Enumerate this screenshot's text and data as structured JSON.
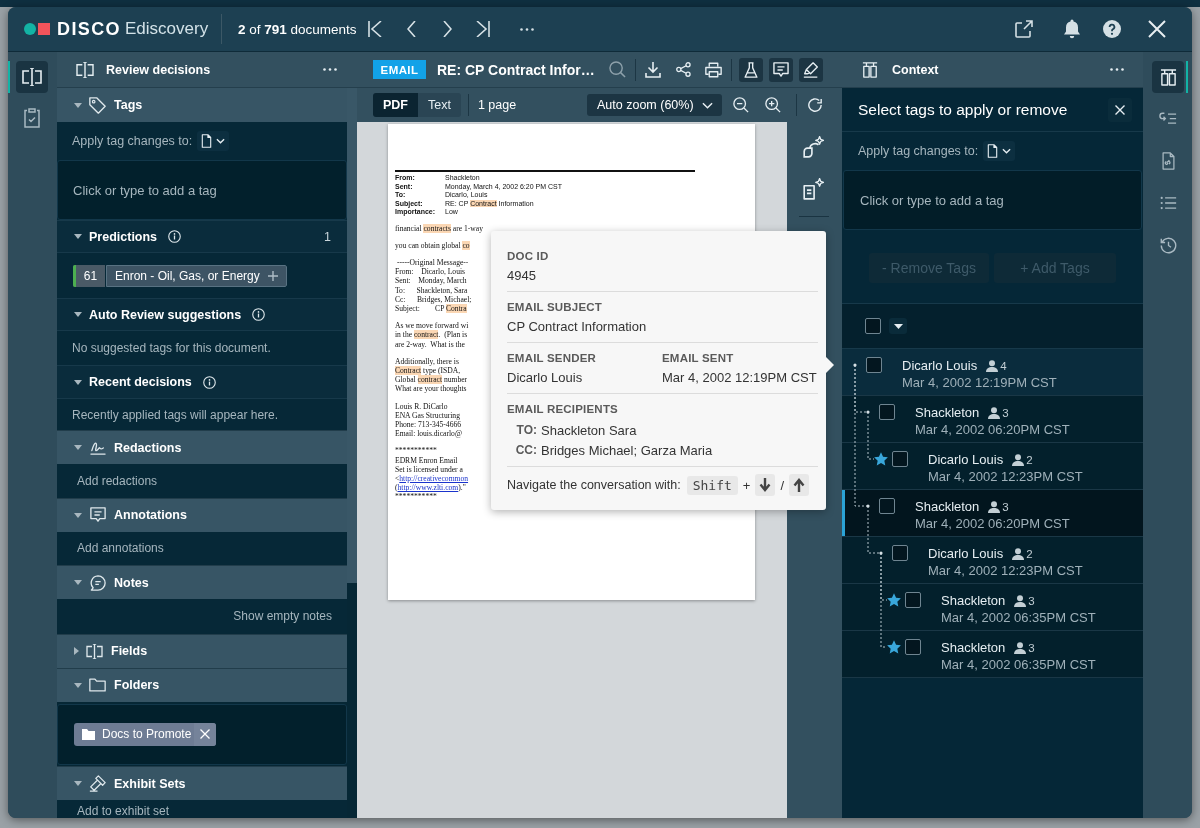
{
  "app_bar": {
    "brand": "DISCO",
    "product": "Ediscovery",
    "position": "**2** of **791** documents"
  },
  "left_rail": [
    {
      "kind": "review",
      "selected": true
    },
    {
      "kind": "checklist",
      "selected": false
    }
  ],
  "review_panel": {
    "title": "Review decisions",
    "sections": [
      {
        "kind": "tags",
        "title": "Tags",
        "expanded": true,
        "apply_label": "Apply tag changes to:",
        "tag_input": {
          "placeholder": "Click or type to add a tag"
        },
        "subsections": [
          {
            "kind": "predictions",
            "title": "Predictions",
            "expanded": true,
            "count": "1",
            "predictions": [
              {
                "score": "61",
                "label": "Enron - Oil, Gas, or Energy"
              }
            ]
          },
          {
            "kind": "message",
            "title": "Auto Review suggestions",
            "expanded": true,
            "message": "No suggested tags for this document."
          },
          {
            "kind": "message",
            "title": "Recent decisions",
            "expanded": true,
            "message": "Recently applied tags will appear here."
          }
        ]
      },
      {
        "kind": "redactions",
        "title": "Redactions",
        "expanded": true,
        "hint": "Add redactions"
      },
      {
        "kind": "annotations",
        "title": "Annotations",
        "expanded": true,
        "hint": "Add annotations"
      },
      {
        "kind": "notes",
        "title": "Notes",
        "expanded": true,
        "link": "Show empty notes"
      },
      {
        "kind": "fields",
        "title": "Fields",
        "expanded": false
      },
      {
        "kind": "folders",
        "title": "Folders",
        "expanded": true,
        "folders": [
          {
            "label": "Docs to Promote"
          }
        ]
      },
      {
        "kind": "exhibit_sets",
        "title": "Exhibit Sets",
        "expanded": true,
        "hint": "Add to exhibit set"
      }
    ]
  },
  "document": {
    "type_badge": "EMAIL",
    "title": "RE: CP Contract Infor…",
    "view_modes": [
      {
        "label": "PDF",
        "selected": true
      },
      {
        "label": "Text",
        "selected": false
      }
    ],
    "page_count": "1 page",
    "zoom": "Auto zoom (60%)",
    "page": {
      "header": [
        {
          "label": "From:",
          "value": [
            {
              "kind": "plain",
              "text": "Shackleton"
            }
          ]
        },
        {
          "label": "Sent:",
          "value": [
            {
              "kind": "plain",
              "text": "Monday, March 4, 2002 6:20 PM CST"
            }
          ]
        },
        {
          "label": "To:",
          "value": [
            {
              "kind": "plain",
              "text": "Dicarlo, Louis"
            }
          ]
        },
        {
          "label": "Subject:",
          "value": [
            {
              "kind": "plain",
              "text": "RE: CP "
            },
            {
              "kind": "highlight",
              "text": "Contract"
            },
            {
              "kind": "plain",
              "text": " Information"
            }
          ]
        },
        {
          "label": "Importance:",
          "value": [
            {
              "kind": "plain",
              "text": "Low"
            }
          ]
        }
      ],
      "paragraphs": [
        [
          [
            {
              "kind": "plain",
              "text": "financial "
            },
            {
              "kind": "highlight",
              "text": "contracts"
            },
            {
              "kind": "plain",
              "text": " are 1-way"
            }
          ]
        ],
        [
          [
            {
              "kind": "plain",
              "text": "you can obtain global "
            },
            {
              "kind": "highlight",
              "text": "co"
            }
          ]
        ],
        [
          [
            {
              "kind": "plain",
              "text": " -----Original Message--"
            }
          ],
          [
            {
              "kind": "plain",
              "text": "From:    Dicarlo, Louis"
            }
          ],
          [
            {
              "kind": "plain",
              "text": "Sent:    Monday, March"
            }
          ],
          [
            {
              "kind": "plain",
              "text": "To:      Shackleton, Sara"
            }
          ],
          [
            {
              "kind": "plain",
              "text": "Cc:      Bridges, Michael;"
            }
          ],
          [
            {
              "kind": "plain",
              "text": "Subject:        CP "
            },
            {
              "kind": "highlight",
              "text": "Contra"
            }
          ]
        ],
        [
          [
            {
              "kind": "plain",
              "text": "As we move forward wi"
            }
          ],
          [
            {
              "kind": "plain",
              "text": "in the "
            },
            {
              "kind": "highlight",
              "text": "contract"
            },
            {
              "kind": "plain",
              "text": ".  (Plan is"
            }
          ],
          [
            {
              "kind": "plain",
              "text": "are 2-way.  What is the"
            }
          ]
        ],
        [
          [
            {
              "kind": "plain",
              "text": "Additionally, there is"
            }
          ],
          [
            {
              "kind": "highlight",
              "text": "Contract"
            },
            {
              "kind": "plain",
              "text": " type (ISDA,"
            }
          ],
          [
            {
              "kind": "plain",
              "text": "Global "
            },
            {
              "kind": "highlight",
              "text": "contract"
            },
            {
              "kind": "plain",
              "text": " number"
            }
          ],
          [
            {
              "kind": "plain",
              "text": "What are your thoughts"
            }
          ]
        ],
        [
          [
            {
              "kind": "plain",
              "text": "Louis R. DiCarlo"
            }
          ],
          [
            {
              "kind": "plain",
              "text": "ENA Gas Structuring"
            }
          ],
          [
            {
              "kind": "plain",
              "text": "Phone: 713-345-4666"
            }
          ],
          [
            {
              "kind": "plain",
              "text": "Email: louis.dicarlo@"
            }
          ]
        ],
        [
          [
            {
              "kind": "plain",
              "text": "***********"
            }
          ],
          [
            {
              "kind": "plain",
              "text": "EDRM Enron Email"
            }
          ],
          [
            {
              "kind": "plain",
              "text": "Set is licensed under a"
            }
          ],
          [
            {
              "kind": "plain",
              "text": "<"
            },
            {
              "kind": "link",
              "text": "http://creativecommon"
            }
          ],
          [
            {
              "kind": "plain",
              "text": "("
            },
            {
              "kind": "link",
              "text": "http://www.zlti.com"
            },
            {
              "kind": "plain",
              "text": ").\""
            }
          ],
          [
            {
              "kind": "plain",
              "text": "***********"
            }
          ]
        ]
      ]
    }
  },
  "doc_popover": {
    "rows": [
      {
        "fields": [
          {
            "label": "DOC ID",
            "value": "4945"
          }
        ]
      },
      {
        "fields": [
          {
            "label": "EMAIL SUBJECT",
            "value": "CP Contract Information"
          }
        ]
      },
      {
        "fields": [
          {
            "label": "EMAIL SENDER",
            "value": "Dicarlo Louis"
          },
          {
            "label": "EMAIL SENT",
            "value": "Mar 4, 2002 12:19PM CST"
          }
        ]
      }
    ],
    "recipients": {
      "label": "EMAIL RECIPIENTS",
      "lines": [
        {
          "role": "TO:",
          "value": "Shackleton Sara"
        },
        {
          "role": "CC:",
          "value": "Bridges Michael; Garza Maria"
        }
      ]
    },
    "shortcut": {
      "text": "Navigate the conversation with:",
      "key": "Shift",
      "plus": "+",
      "separator": "/"
    }
  },
  "context_panel": {
    "title": "Context",
    "tag_editor": {
      "title": "Select tags to apply or remove",
      "apply_label": "Apply tag changes to:",
      "tag_input": {
        "placeholder": "Click or type to add a tag"
      },
      "buttons": [
        {
          "label": "- Remove Tags",
          "disabled": true
        },
        {
          "label": "+ Add Tags",
          "disabled": true
        }
      ]
    },
    "select_all": {
      "checked": false
    },
    "thread": [
      {
        "name": "Dicarlo Louis",
        "participants": "4",
        "date": "Mar 4, 2002 12:19PM CST",
        "starred": false,
        "checked": false,
        "selected": false,
        "current": true,
        "children": [
          {
            "name": "Shackleton",
            "participants": "3",
            "date": "Mar 4, 2002 06:20PM CST",
            "starred": false,
            "checked": false,
            "selected": false,
            "current": false,
            "children": [
              {
                "name": "Dicarlo Louis",
                "participants": "2",
                "date": "Mar 4, 2002 12:23PM CST",
                "starred": true,
                "checked": false,
                "selected": false,
                "current": false
              }
            ]
          },
          {
            "name": "Shackleton",
            "participants": "3",
            "date": "Mar 4, 2002 06:20PM CST",
            "starred": false,
            "checked": false,
            "selected": true,
            "current": false,
            "children": [
              {
                "name": "Dicarlo Louis",
                "participants": "2",
                "date": "Mar 4, 2002 12:23PM CST",
                "starred": false,
                "checked": false,
                "selected": false,
                "current": false,
                "children": [
                  {
                    "name": "Shackleton",
                    "participants": "3",
                    "date": "Mar 4, 2002 06:35PM CST",
                    "starred": true,
                    "checked": false,
                    "selected": false,
                    "current": false
                  },
                  {
                    "name": "Shackleton",
                    "participants": "3",
                    "date": "Mar 4, 2002 06:35PM CST",
                    "starred": true,
                    "checked": false,
                    "selected": false,
                    "current": false
                  }
                ]
              }
            ]
          }
        ]
      }
    ]
  },
  "right_rail": [
    {
      "kind": "context",
      "selected": true
    },
    {
      "kind": "threads",
      "selected": false
    },
    {
      "kind": "linked",
      "selected": false
    },
    {
      "kind": "list",
      "selected": false
    },
    {
      "kind": "history",
      "selected": false
    }
  ]
}
